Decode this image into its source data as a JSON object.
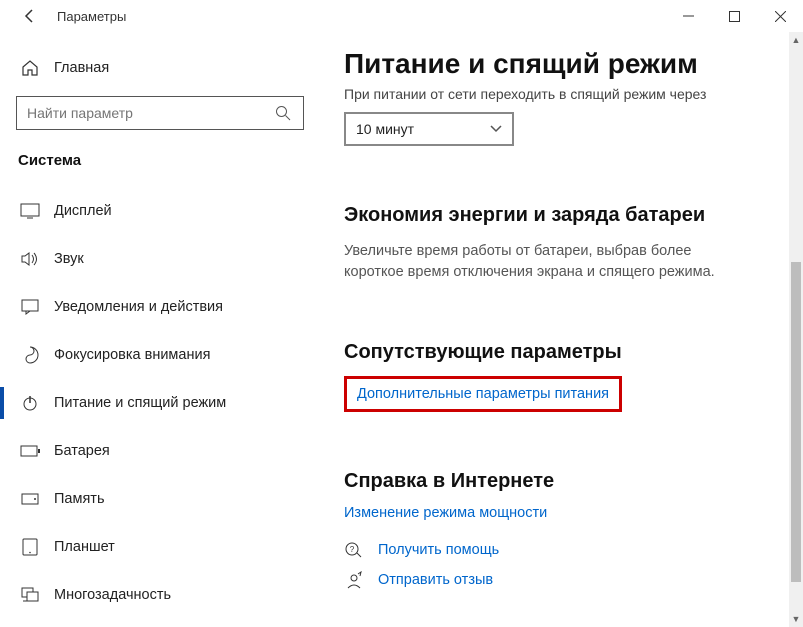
{
  "window": {
    "title": "Параметры"
  },
  "sidebar": {
    "home": "Главная",
    "search_placeholder": "Найти параметр",
    "category": "Система",
    "items": [
      {
        "label": "Дисплей",
        "icon": "display"
      },
      {
        "label": "Звук",
        "icon": "sound"
      },
      {
        "label": "Уведомления и действия",
        "icon": "notifications"
      },
      {
        "label": "Фокусировка внимания",
        "icon": "focus"
      },
      {
        "label": "Питание и спящий режим",
        "icon": "power",
        "active": true
      },
      {
        "label": "Батарея",
        "icon": "battery"
      },
      {
        "label": "Память",
        "icon": "storage"
      },
      {
        "label": "Планшет",
        "icon": "tablet"
      },
      {
        "label": "Многозадачность",
        "icon": "multitask"
      }
    ]
  },
  "content": {
    "page_title": "Питание и спящий режим",
    "sleep_label": "При питании от сети переходить в спящий режим через",
    "sleep_value": "10 минут",
    "economy_title": "Экономия энергии и заряда батареи",
    "economy_body": "Увеличьте время работы от батареи, выбрав более короткое время отключения экрана и спящего режима.",
    "related_title": "Сопутствующие параметры",
    "related_link": "Дополнительные параметры питания",
    "help_title": "Справка в Интернете",
    "help_link": "Изменение режима мощности",
    "get_help": "Получить помощь",
    "feedback": "Отправить отзыв"
  }
}
